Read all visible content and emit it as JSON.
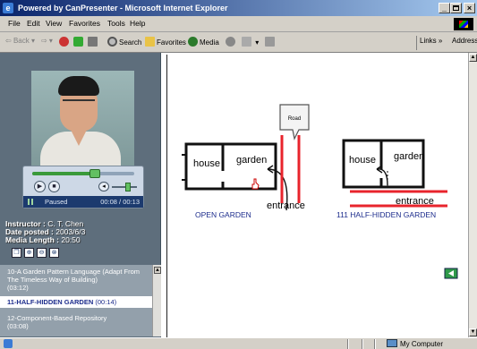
{
  "window": {
    "title": "Powered by CanPresenter - Microsoft Internet Explorer",
    "minimize_glyph": "_",
    "maximize_glyph": " ",
    "close_glyph": "×"
  },
  "menu": [
    "File",
    "Edit",
    "View",
    "Favorites",
    "Tools",
    "Help"
  ],
  "toolbar": {
    "back_label": "Back",
    "back_glyph": "⇦",
    "forward_glyph": "⇨",
    "search_label": "Search",
    "favorites_label": "Favorites",
    "media_label": "Media",
    "links_label": "Links »",
    "address_label": "Address"
  },
  "player": {
    "status": "Paused",
    "time": "00:08 / 00:13",
    "progress": 0.615,
    "volume": 0.65,
    "play_glyph": "▶",
    "stop_glyph": "■",
    "vol_glyph": "◂"
  },
  "info": {
    "instructor_label": "Instructor :",
    "instructor": "C. T. Chen",
    "date_label": "Date posted :",
    "date": "2003/6/3",
    "length_label": "Media Length :",
    "length": "20:50"
  },
  "tools": [
    "❐",
    "⊕",
    "⊖",
    "⊗"
  ],
  "playlist": [
    {
      "title": "10-A Garden Pattern Language (Adapt From The Timeless Way of Building)",
      "duration": "(03:12)",
      "active": false
    },
    {
      "title": "11-HALF-HIDDEN GARDEN",
      "duration": "(00:14)",
      "active": true
    },
    {
      "title": "12-Component-Based Repository",
      "duration": "(03:08)",
      "active": false
    }
  ],
  "slide": {
    "road_label": "Road",
    "house_label": "house",
    "garden_label": "garden",
    "entrance_label": "entrance",
    "left_caption": "OPEN GARDEN",
    "right_caption": "111 HALF-HIDDEN GARDEN",
    "accent_red": "#e8242c",
    "caption_blue": "#1c2c8c"
  },
  "statusbar": {
    "zone": "My Computer"
  }
}
